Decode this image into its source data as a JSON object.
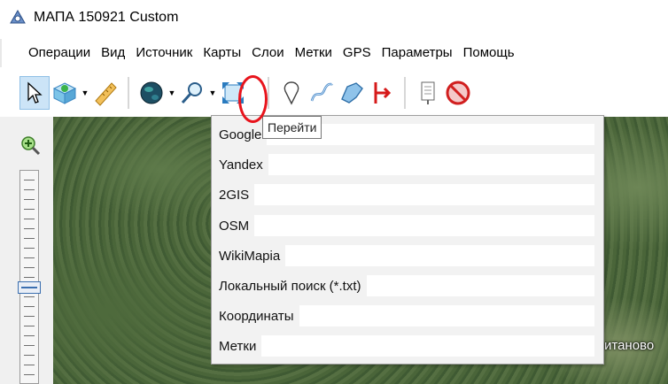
{
  "window": {
    "title": "МАПА 150921 Custom",
    "icon": "map-app-icon"
  },
  "menu": {
    "items": [
      "Операции",
      "Вид",
      "Источник",
      "Карты",
      "Слои",
      "Метки",
      "GPS",
      "Параметры",
      "Помощь"
    ]
  },
  "toolbar": {
    "buttons": [
      {
        "name": "select-pointer",
        "icon": "cursor-arrow-icon",
        "pressed": true
      },
      {
        "name": "map-tiles",
        "icon": "tiles-icon",
        "dropdown": true
      },
      {
        "name": "ruler",
        "icon": "ruler-icon"
      },
      {
        "name": "globe",
        "icon": "globe-icon",
        "dropdown": true
      },
      {
        "name": "search-goto",
        "icon": "magnifier-icon",
        "dropdown": true
      },
      {
        "name": "fullscreen",
        "icon": "expand-arrows-icon"
      },
      {
        "name": "placemark",
        "icon": "pin-icon"
      },
      {
        "name": "track",
        "icon": "track-icon"
      },
      {
        "name": "polygon",
        "icon": "polygon-icon"
      },
      {
        "name": "line-marker",
        "icon": "red-bracket-icon"
      },
      {
        "name": "notes",
        "icon": "note-icon"
      },
      {
        "name": "cancel",
        "icon": "prohibited-icon"
      }
    ]
  },
  "tooltip": {
    "text": "Перейти"
  },
  "goto_menu": {
    "items": [
      {
        "label": "Google",
        "value": ""
      },
      {
        "label": "Yandex",
        "value": ""
      },
      {
        "label": "2GIS",
        "value": ""
      },
      {
        "label": "OSM",
        "value": ""
      },
      {
        "label": "WikiMapia",
        "value": ""
      },
      {
        "label": "Локальный поиск (*.txt)",
        "value": ""
      },
      {
        "label": "Координаты",
        "value": ""
      },
      {
        "label": "Метки",
        "value": ""
      }
    ]
  },
  "map": {
    "place_label": "итаново"
  },
  "colors": {
    "annotation": "#e8141c",
    "pressed_button": "#cce4f7"
  }
}
